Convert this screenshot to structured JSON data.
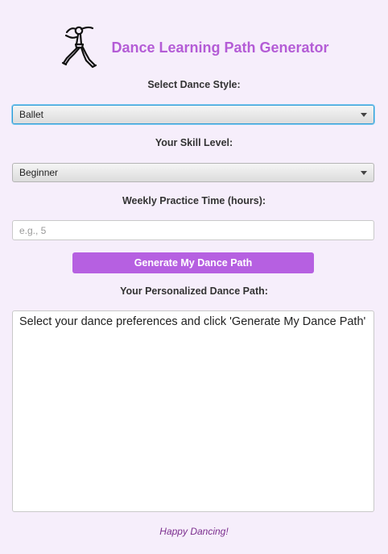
{
  "header": {
    "title": "Dance Learning Path Generator",
    "logo_icon": "dancer-icon"
  },
  "form": {
    "style_label": "Select Dance Style:",
    "style_value": "Ballet",
    "skill_label": "Your Skill Level:",
    "skill_value": "Beginner",
    "time_label": "Weekly Practice Time (hours):",
    "time_placeholder": "e.g., 5",
    "time_value": "",
    "generate_label": "Generate My Dance Path"
  },
  "result": {
    "label": "Your Personalized Dance Path:",
    "text": "Select your dance preferences and click 'Generate My Dance Path'"
  },
  "footer": {
    "text": "Happy Dancing!"
  },
  "colors": {
    "background": "#f6eefb",
    "accent": "#b660e1",
    "title": "#b45cd6",
    "footer": "#7b2d8e",
    "focus": "#2a9bd8"
  }
}
